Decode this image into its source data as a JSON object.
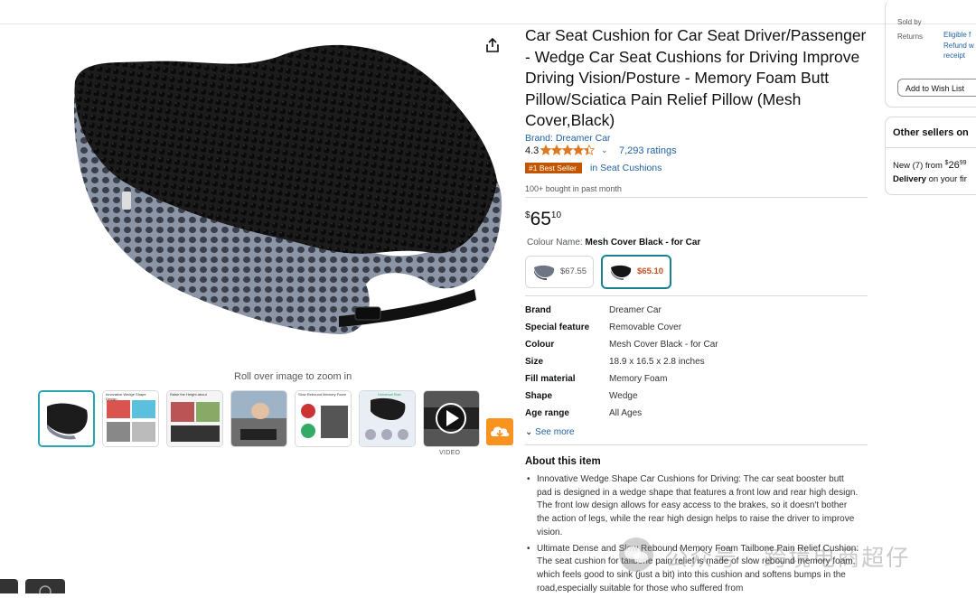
{
  "product": {
    "title": "Car Seat Cushion for Car Seat Driver/Passenger - Wedge Car Seat Cushions for Driving Improve Driving Vision/Posture - Memory Foam Butt Pillow/Sciatica Pain Relief Pillow (Mesh Cover,Black)",
    "brand_link": "Brand: Dreamer Car",
    "rating": "4.3",
    "rating_stars": 4.3,
    "ratings_count": "7,293 ratings",
    "badge": "#1 Best Seller",
    "badge_category": "in Seat Cushions",
    "bought": "100+ bought in past month",
    "price": {
      "symbol": "$",
      "whole": "65",
      "fraction": "10"
    },
    "colour_label": "Colour Name:",
    "colour_value": "Mesh Cover Black - for Car",
    "swatches": [
      {
        "price": "$67.55",
        "selected": false
      },
      {
        "price": "$65.10",
        "selected": true
      }
    ],
    "specs": [
      {
        "key": "Brand",
        "value": "Dreamer Car"
      },
      {
        "key": "Special feature",
        "value": "Removable Cover"
      },
      {
        "key": "Colour",
        "value": "Mesh Cover Black - for Car"
      },
      {
        "key": "Size",
        "value": "18.9 x 16.5 x 2.8 inches"
      },
      {
        "key": "Fill material",
        "value": "Memory Foam"
      },
      {
        "key": "Shape",
        "value": "Wedge"
      },
      {
        "key": "Age range",
        "value": "All Ages"
      }
    ],
    "see_more": "See more",
    "about_heading": "About this item",
    "bullets": [
      "Innovative Wedge Shape Car Cushions for Driving: The car seat booster butt pad is designed in a wedge shape that features a front low and rear high design. The front low design allows for easy access to the brakes, so it doesn't bother the action of legs, while the rear high design helps to raise the driver to improve vision.",
      "Ultimate Dense and Slow Rebound Memory Foam Tailbone Pain Relief Cushion: The seat cushion for tailbone pain relief is made of slow rebound memory foam, which feels good to sink (just a bit) into this cushion and softens bumps in the road,especially suitable for those who suffered from"
    ]
  },
  "gallery": {
    "rollover_hint": "Roll over image to zoom in",
    "video_label": "VIDEO",
    "thumbnails": [
      {
        "name": "thumb-cushion-black",
        "caption": ""
      },
      {
        "name": "thumb-wedge-design",
        "caption": "Innovative Wedge Shape Design"
      },
      {
        "name": "thumb-raise-height",
        "caption": "Raise the Height about"
      },
      {
        "name": "thumb-driving-scene",
        "caption": ""
      },
      {
        "name": "thumb-slow-rebound",
        "caption": "Slow Rebound Memory Foam"
      },
      {
        "name": "thumb-universal-size",
        "caption": "Universal Size"
      },
      {
        "name": "thumb-video",
        "caption": ""
      }
    ]
  },
  "sidebar": {
    "sold_by": "Sold by",
    "returns": "Returns",
    "returns_lines": [
      "Eligible f",
      "Refund w",
      "receipt"
    ],
    "wish_list": "Add to Wish List",
    "other_sellers": "Other sellers on",
    "new_from": "New (7) from",
    "new_price_sym": "$",
    "new_price": "26",
    "new_price_frac": "99",
    "delivery": "Delivery",
    "delivery_rest": "on your fir"
  },
  "watermark": {
    "text": "公众号 · 跨境电商超仔"
  },
  "colors": {
    "link": "#2162a1",
    "badge": "#c45500",
    "star": "#de7921",
    "accent": "#2aa3b5",
    "download": "#f7931e"
  }
}
